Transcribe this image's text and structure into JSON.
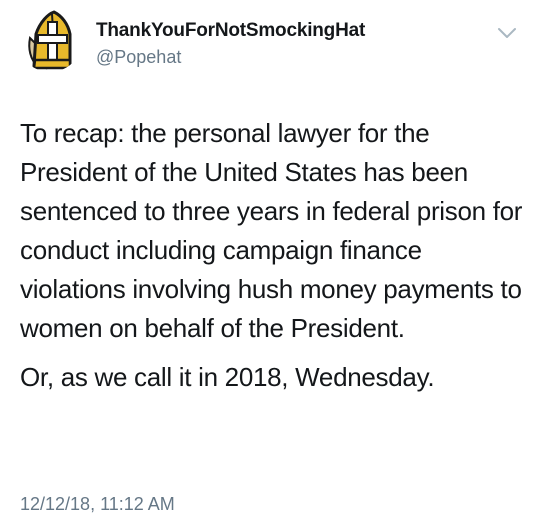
{
  "tweet": {
    "display_name": "ThankYouForNotSmockingHat",
    "handle": "@Popehat",
    "body_paragraphs": [
      "To recap: the personal lawyer for the President of the United States has been sentenced to three years in federal prison for conduct including campaign finance violations involving hush money payments to women on behalf of the President.",
      "Or, as we call it in 2018, Wednesday."
    ],
    "timestamp": "12/12/18, 11:12 AM",
    "avatar_icon": "papal-mitre-hat-icon",
    "menu_icon": "chevron-down-icon"
  },
  "colors": {
    "text_primary": "#14171a",
    "text_secondary": "#657786",
    "mitre_gold": "#e8b92b",
    "mitre_outline": "#1a1a1a"
  }
}
